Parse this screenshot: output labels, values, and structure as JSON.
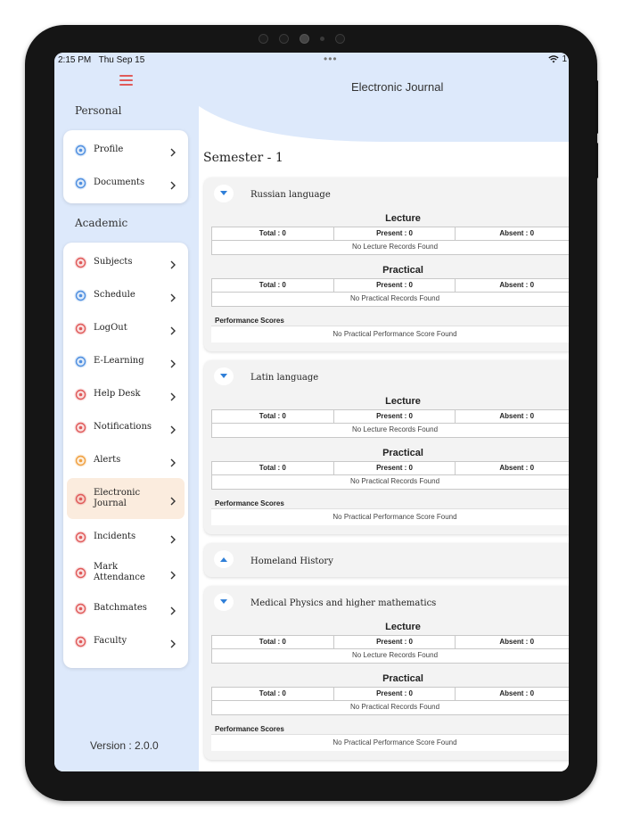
{
  "status": {
    "time": "2:15 PM",
    "date": "Thu Sep 15",
    "battery": "1"
  },
  "sidebar": {
    "personal_label": "Personal",
    "academic_label": "Academic",
    "personal_items": [
      {
        "label": "Profile",
        "icon": "profile-icon",
        "color": "#4f8fe0"
      },
      {
        "label": "Documents",
        "icon": "documents-icon",
        "color": "#4f8fe0"
      }
    ],
    "academic_items": [
      {
        "label": "Subjects",
        "icon": "subjects-icon",
        "color": "#e05a5a"
      },
      {
        "label": "Schedule",
        "icon": "schedule-icon",
        "color": "#4f8fe0"
      },
      {
        "label": "LogOut",
        "icon": "logout-icon",
        "color": "#e05a5a"
      },
      {
        "label": "E-Learning",
        "icon": "elearning-icon",
        "color": "#4f8fe0"
      },
      {
        "label": "Help Desk",
        "icon": "helpdesk-icon",
        "color": "#e05a5a"
      },
      {
        "label": "Notifications",
        "icon": "notifications-icon",
        "color": "#e05a5a"
      },
      {
        "label": "Alerts",
        "icon": "alerts-icon",
        "color": "#f0a040"
      },
      {
        "label": "Electronic Journal",
        "icon": "journal-icon",
        "color": "#e05a5a",
        "active": true
      },
      {
        "label": "Incidents",
        "icon": "incidents-icon",
        "color": "#e05a5a"
      },
      {
        "label": "Mark Attendance",
        "icon": "attendance-icon",
        "color": "#e05a5a"
      },
      {
        "label": "Batchmates",
        "icon": "batchmates-icon",
        "color": "#e05a5a"
      },
      {
        "label": "Faculty",
        "icon": "faculty-icon",
        "color": "#e05a5a"
      }
    ],
    "version": "Version :  2.0.0"
  },
  "header": {
    "title": "Electronic Journal"
  },
  "semester": "Semester - 1",
  "subjects": [
    {
      "name": "Russian language",
      "expanded": true,
      "lecture": {
        "title": "Lecture",
        "total": "Total : 0",
        "present": "Present : 0",
        "absent": "Absent : 0",
        "empty": "No Lecture Records Found"
      },
      "practical": {
        "title": "Practical",
        "total": "Total : 0",
        "present": "Present : 0",
        "absent": "Absent : 0",
        "empty": "No Practical Records Found"
      },
      "performance": {
        "label": "Performance Scores",
        "empty": "No Practical Performance Score Found"
      }
    },
    {
      "name": "Latin language",
      "expanded": true,
      "lecture": {
        "title": "Lecture",
        "total": "Total : 0",
        "present": "Present : 0",
        "absent": "Absent : 0",
        "empty": "No Lecture Records Found"
      },
      "practical": {
        "title": "Practical",
        "total": "Total : 0",
        "present": "Present : 0",
        "absent": "Absent : 0",
        "empty": "No Practical Records Found"
      },
      "performance": {
        "label": "Performance Scores",
        "empty": "No Practical Performance Score Found"
      }
    },
    {
      "name": "Homeland History",
      "expanded": false
    },
    {
      "name": "Medical Physics and higher mathematics",
      "expanded": true,
      "lecture": {
        "title": "Lecture",
        "total": "Total : 0",
        "present": "Present : 0",
        "absent": "Absent : 0",
        "empty": "No Lecture Records Found"
      },
      "practical": {
        "title": "Practical",
        "total": "Total : 0",
        "present": "Present : 0",
        "absent": "Absent : 0",
        "empty": "No Practical Records Found"
      },
      "performance": {
        "label": "Performance Scores",
        "empty": "No Practical Performance Score Found"
      }
    }
  ],
  "colors": {
    "accent": "#2f7fd8",
    "sidebar_bg": "#dde9fb",
    "active_item": "#fbecde",
    "menu": "#e05a5a"
  }
}
